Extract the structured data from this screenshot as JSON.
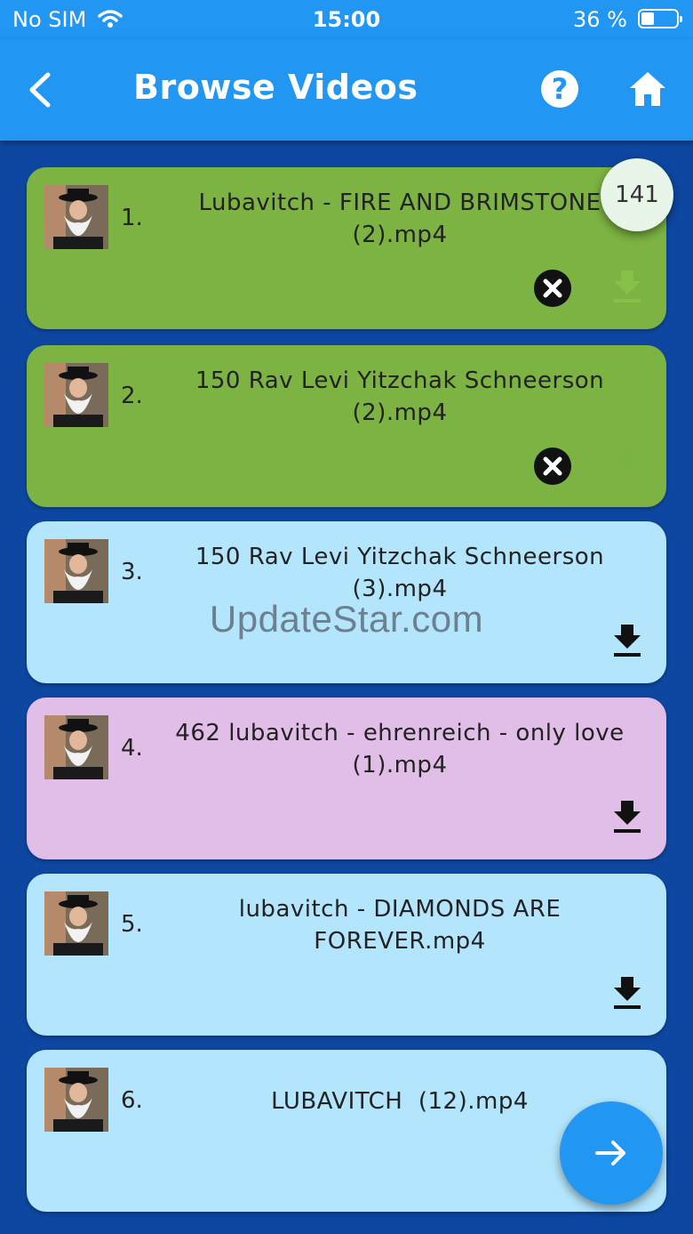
{
  "status_bar": {
    "carrier": "No SIM",
    "time": "15:00",
    "battery_percent": "36 %",
    "battery_level": 0.36
  },
  "header": {
    "title": "Browse Videos",
    "back_icon": "chevron-left-icon",
    "help_icon": "help-circle-icon",
    "home_icon": "home-icon"
  },
  "badge": {
    "count": "141"
  },
  "videos": [
    {
      "number": "1.",
      "title": "Lubavitch - FIRE AND BRIMSTONE (2).mp4",
      "state": "downloaded",
      "color": "#7cb342"
    },
    {
      "number": "2.",
      "title": "150 Rav Levi Yitzchak Schneerson (2).mp4",
      "state": "downloaded",
      "color": "#7cb342"
    },
    {
      "number": "3.",
      "title": "150 Rav Levi Yitzchak Schneerson (3).mp4",
      "state": "available",
      "color": "#b3e5fc"
    },
    {
      "number": "4.",
      "title": "462 lubavitch - ehrenreich - only love (1).mp4",
      "state": "available",
      "color": "#e1bee7"
    },
    {
      "number": "5.",
      "title": "lubavitch - DIAMONDS ARE FOREVER.mp4",
      "state": "available",
      "color": "#b3e5fc"
    },
    {
      "number": "6.",
      "title": "LUBAVITCH  (12).mp4",
      "state": "available",
      "color": "#b3e5fc"
    }
  ],
  "watermark": "UpdateStar.com",
  "fab_icon": "arrow-right-icon"
}
